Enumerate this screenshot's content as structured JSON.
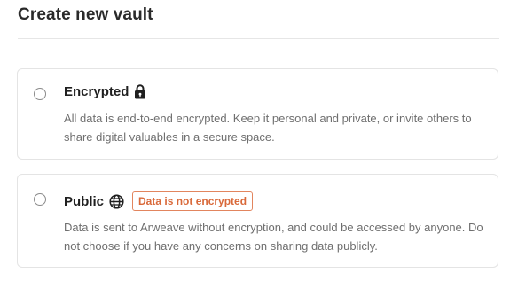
{
  "header": {
    "title": "Create new vault"
  },
  "options": [
    {
      "title": "Encrypted",
      "icon": "lock-icon",
      "description": "All data is end-to-end encrypted. Keep it personal and private, or invite others to share digital valuables in a secure space.",
      "selected": false
    },
    {
      "title": "Public",
      "icon": "globe-icon",
      "badge": "Data is not encrypted",
      "badge_color": "#d9693a",
      "description": "Data is sent to Arweave without encryption, and could be accessed by anyone. Do not choose if you have any concerns on sharing data publicly.",
      "selected": false
    }
  ]
}
